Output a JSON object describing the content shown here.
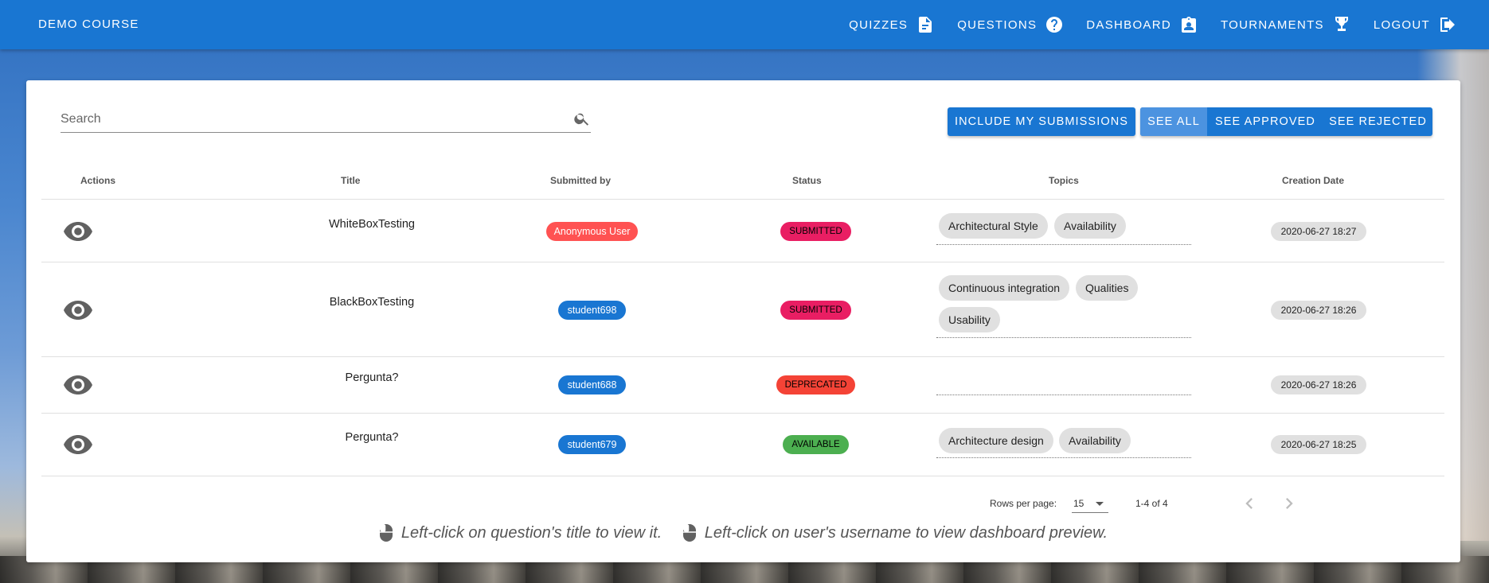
{
  "app": {
    "title": "DEMO COURSE"
  },
  "nav": [
    {
      "label": "QUIZZES",
      "icon": "file-document-icon"
    },
    {
      "label": "QUESTIONS",
      "icon": "help-circle-icon"
    },
    {
      "label": "DASHBOARD",
      "icon": "account-box-icon"
    },
    {
      "label": "TOURNAMENTS",
      "icon": "trophy-icon"
    },
    {
      "label": "LOGOUT",
      "icon": "logout-icon"
    }
  ],
  "search": {
    "placeholder": "Search",
    "value": ""
  },
  "actions": {
    "include_label": "INCLUDE MY SUBMISSIONS",
    "filters": [
      "SEE ALL",
      "SEE APPROVED",
      "SEE REJECTED"
    ],
    "active_filter": "SEE ALL"
  },
  "table": {
    "headers": [
      "Actions",
      "Title",
      "Submitted by",
      "Status",
      "Topics",
      "Creation Date"
    ],
    "rows": [
      {
        "title": "WhiteBoxTesting",
        "user": "Anonymous User",
        "status": "SUBMITTED",
        "topics": [
          "Architectural Style",
          "Availability"
        ],
        "date": "2020-06-27 18:27"
      },
      {
        "title": "BlackBoxTesting",
        "user": "student698",
        "status": "SUBMITTED",
        "topics": [
          "Continuous integration",
          "Qualities",
          "Usability"
        ],
        "date": "2020-06-27 18:26"
      },
      {
        "title": "Pergunta?",
        "user": "student688",
        "status": "DEPRECATED",
        "topics": [],
        "date": "2020-06-27 18:26"
      },
      {
        "title": "Pergunta?",
        "user": "student679",
        "status": "AVAILABLE",
        "topics": [
          "Architecture design",
          "Availability"
        ],
        "date": "2020-06-27 18:25"
      }
    ]
  },
  "pagination": {
    "rows_label": "Rows per page:",
    "rows_value": "15",
    "range": "1-4 of 4"
  },
  "hints": [
    "Left-click on question's title to view it.",
    "Left-click on user's username to view dashboard preview."
  ],
  "colors": {
    "primary": "#1976d2",
    "anonymous": "#ff5252",
    "user": "#1976d2",
    "submitted": "#e91e63",
    "deprecated": "#f44336",
    "available": "#4caf50"
  }
}
